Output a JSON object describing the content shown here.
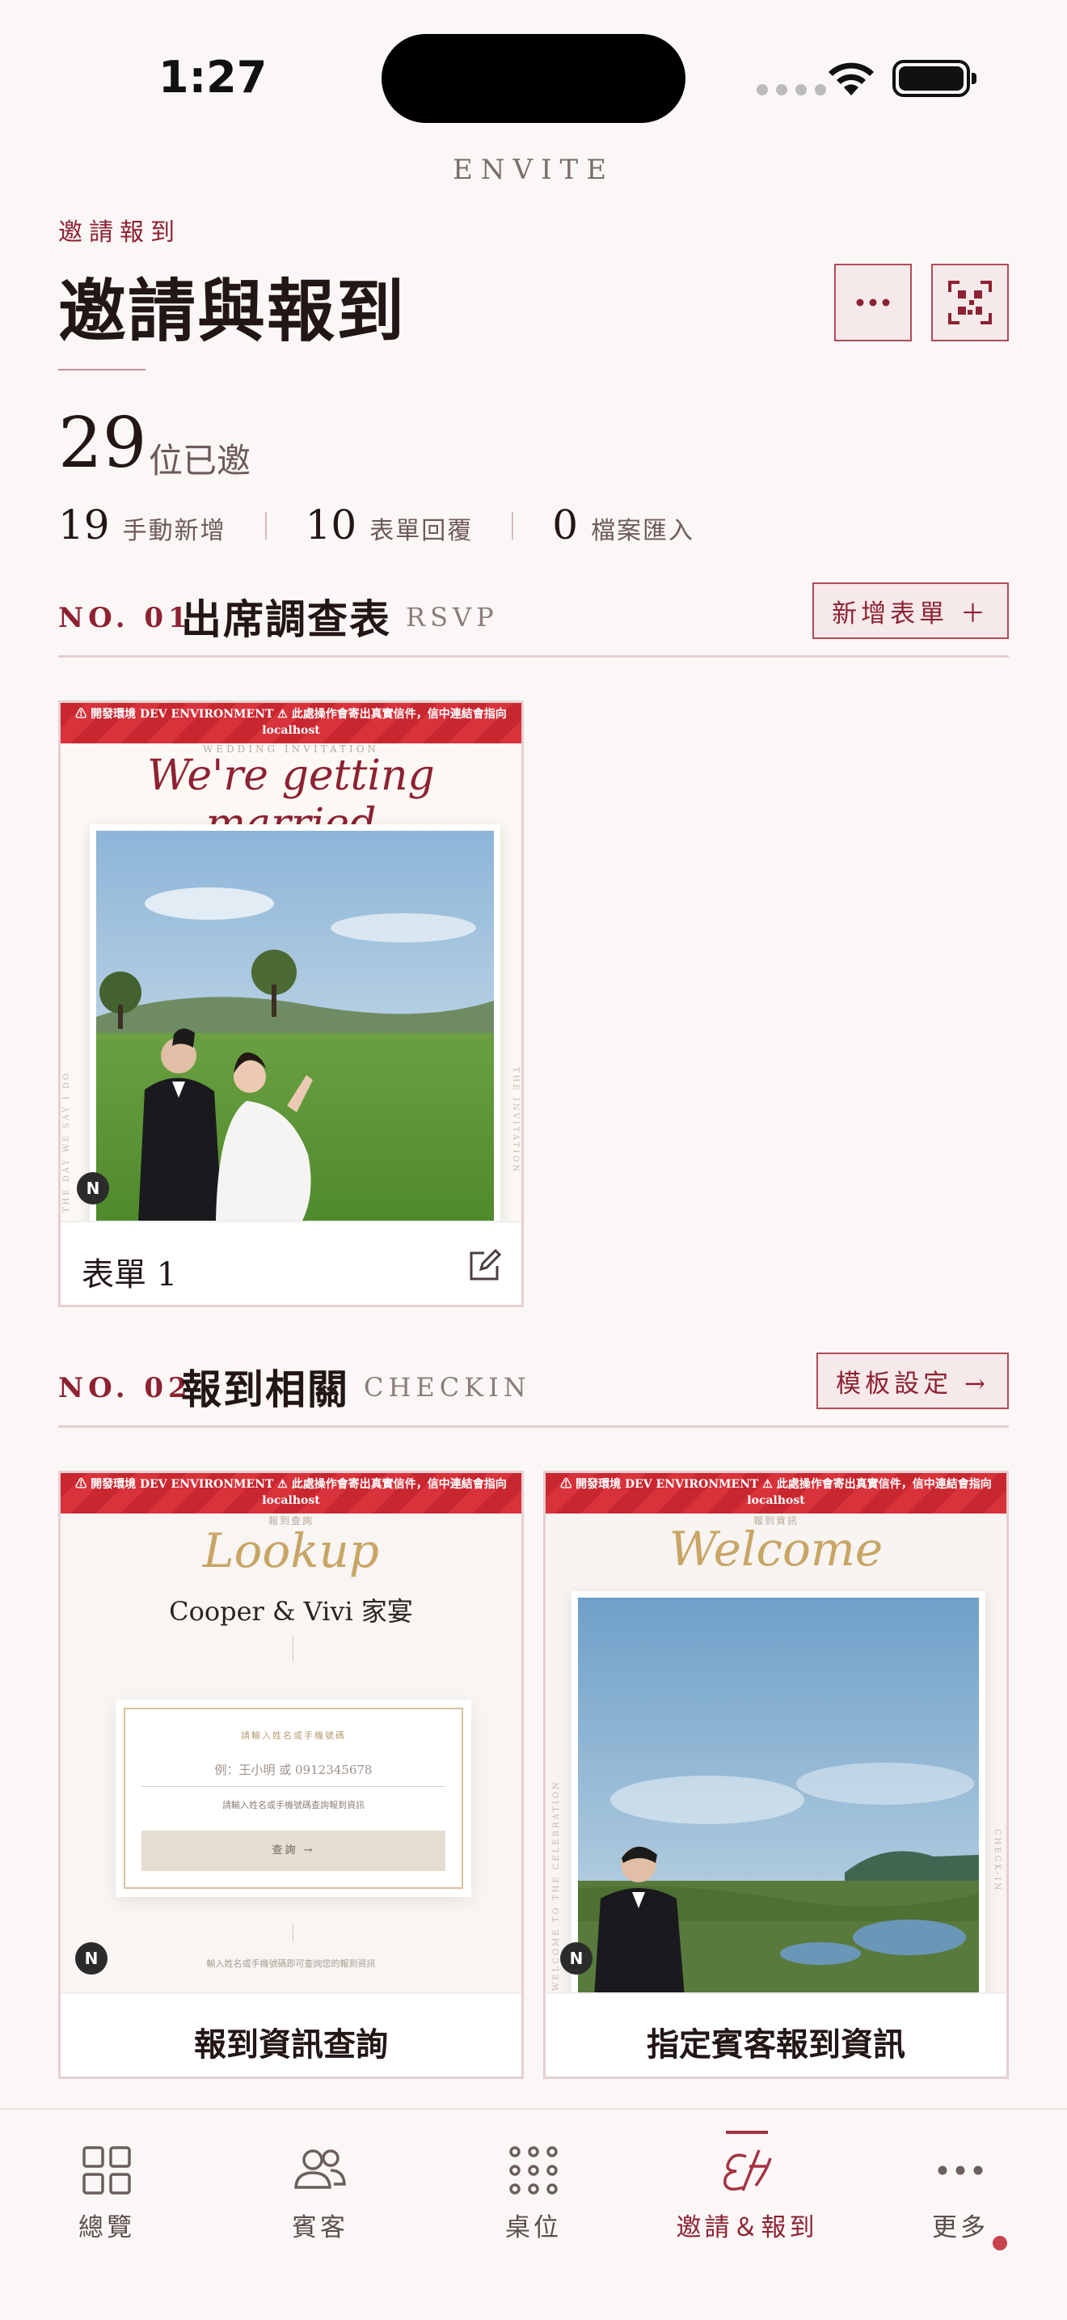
{
  "status": {
    "time": "1:27"
  },
  "brand": "ENVITE",
  "header": {
    "kicker": "邀請報到",
    "title": "邀請與報到"
  },
  "stats": {
    "invited_count": "29",
    "invited_label": "位已邀",
    "items": [
      {
        "value": "19",
        "label": "手動新增"
      },
      {
        "value": "10",
        "label": "表單回覆"
      },
      {
        "value": "0",
        "label": "檔案匯入"
      }
    ]
  },
  "sections": [
    {
      "no": "NO. 01",
      "title": "出席調查表",
      "en": "RSVP",
      "button": "新增表單 ＋",
      "cards": [
        {
          "banner": "⚠ 開發環境 DEV ENVIRONMENT ⚠ 此處操作會寄出真實信件，信中連結會指向 localhost",
          "overline": "WEDDING INVITATION",
          "script": "We're getting married",
          "side_left": "THE DAY WE SAY I DO",
          "side_right": "THE INVITATION",
          "title": "表單 1"
        }
      ]
    },
    {
      "no": "NO. 02",
      "title": "報到相關",
      "en": "CHECKIN",
      "button": "模板設定 →",
      "cards": [
        {
          "banner": "⚠ 開發環境 DEV ENVIRONMENT ⚠ 此處操作會寄出真實信件，信中連結會指向 localhost",
          "overline": "報到查詢",
          "script": "Lookup",
          "couple": "Cooper & Vivi 家宴",
          "form_label": "請輸入姓名或手機號碼",
          "input_placeholder": "例：王小明 或 0912345678",
          "form_hint": "請輸入姓名或手機號碼查詢報到資訊",
          "form_button": "查詢 →",
          "footer_hint": "輸入姓名或手機號碼即可查詢您的報到資訊",
          "title": "報到資訊查詢"
        },
        {
          "banner": "⚠ 開發環境 DEV ENVIRONMENT ⚠ 此處操作會寄出真實信件，信中連結會指向 localhost",
          "overline": "報到資訊",
          "script": "Welcome",
          "side_left": "WELCOME TO THE CELEBRATION",
          "side_right": "CHECK-IN",
          "title": "指定賓客報到資訊"
        }
      ]
    }
  ],
  "tabbar": [
    {
      "label": "總覽",
      "icon": "grid-icon",
      "active": false
    },
    {
      "label": "賓客",
      "icon": "people-icon",
      "active": false
    },
    {
      "label": "桌位",
      "icon": "dots-grid-icon",
      "active": false
    },
    {
      "label": "邀請＆報到",
      "icon": "monogram-icon",
      "active": true
    },
    {
      "label": "更多",
      "icon": "more-icon",
      "active": false,
      "badge": true
    }
  ],
  "colors": {
    "accent": "#8d2232",
    "background": "#fbf7f6",
    "danger_banner": "#d32f38"
  }
}
